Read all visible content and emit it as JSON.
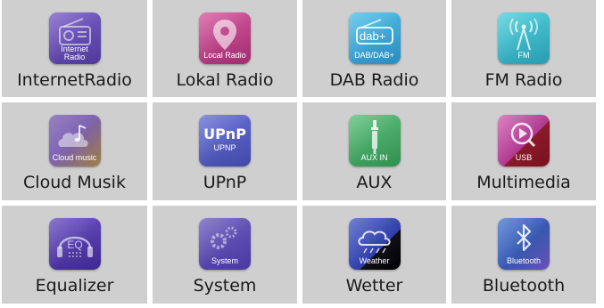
{
  "menu": {
    "tiles": [
      {
        "label": "InternetRadio",
        "icon_caption": "Internet Radio",
        "icon_caption_1": "Internet",
        "icon_caption_2": "Radio",
        "icon": "radio-icon",
        "color": "#6a4fb0"
      },
      {
        "label": "Lokal Radio",
        "icon_caption": "Local Radio",
        "icon": "map-pin-icon",
        "color": "#c0448a"
      },
      {
        "label": "DAB Radio",
        "icon_caption": "DAB/DAB+",
        "icon_text": "dab+",
        "icon": "dab-icon",
        "color": "#3aa9d8"
      },
      {
        "label": "FM Radio",
        "icon_caption": "FM",
        "icon": "antenna-icon",
        "color": "#38b8c8"
      },
      {
        "label": "Cloud Musik",
        "icon_caption": "Cloud music",
        "icon": "cloud-music-icon",
        "color": "#8a6a9a"
      },
      {
        "label": "UPnP",
        "icon_caption": "UPNP",
        "icon_text": "UPnP",
        "icon": "upnp-icon",
        "color": "#5860c8"
      },
      {
        "label": "AUX",
        "icon_caption": "AUX IN",
        "icon": "aux-plug-icon",
        "color": "#4aa96a"
      },
      {
        "label": "Multimedia",
        "icon_caption": "USB",
        "icon": "play-usb-icon",
        "color": "#b0308a"
      },
      {
        "label": "Equalizer",
        "icon_caption": "",
        "icon_text": "EQ",
        "icon": "equalizer-icon",
        "color": "#5a3fa8"
      },
      {
        "label": "System",
        "icon_caption": "System",
        "icon": "gear-icon",
        "color": "#6050b0"
      },
      {
        "label": "Wetter",
        "icon_caption": "Weather",
        "icon": "weather-cloud-icon",
        "color": "#3a4ab0"
      },
      {
        "label": "Bluetooth",
        "icon_caption": "Bluetooth",
        "icon": "bluetooth-icon",
        "color": "#4870c0"
      }
    ]
  }
}
